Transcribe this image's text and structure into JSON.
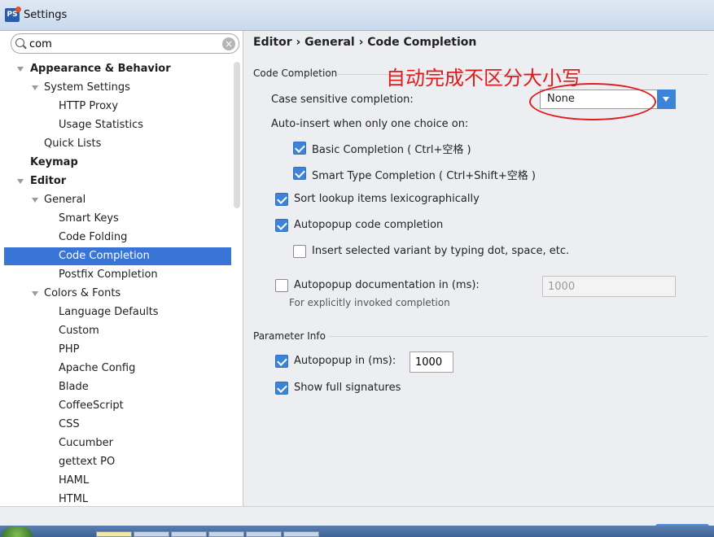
{
  "window": {
    "title": "Settings",
    "icon": "phpstorm-icon"
  },
  "search": {
    "value": "com"
  },
  "tree": [
    {
      "label": "Appearance & Behavior",
      "level": 0,
      "bold": true,
      "expanded": true
    },
    {
      "label": "System Settings",
      "level": 1,
      "expanded": true
    },
    {
      "label": "HTTP Proxy",
      "level": 2
    },
    {
      "label": "Usage Statistics",
      "level": 2
    },
    {
      "label": "Quick Lists",
      "level": 1
    },
    {
      "label": "Keymap",
      "level": 0,
      "bold": true
    },
    {
      "label": "Editor",
      "level": 0,
      "bold": true,
      "expanded": true
    },
    {
      "label": "General",
      "level": 1,
      "expanded": true
    },
    {
      "label": "Smart Keys",
      "level": 2
    },
    {
      "label": "Code Folding",
      "level": 2
    },
    {
      "label": "Code Completion",
      "level": 2,
      "selected": true
    },
    {
      "label": "Postfix Completion",
      "level": 2
    },
    {
      "label": "Colors & Fonts",
      "level": 1,
      "expanded": true
    },
    {
      "label": "Language Defaults",
      "level": 2
    },
    {
      "label": "Custom",
      "level": 2
    },
    {
      "label": "PHP",
      "level": 2
    },
    {
      "label": "Apache Config",
      "level": 2
    },
    {
      "label": "Blade",
      "level": 2
    },
    {
      "label": "CoffeeScript",
      "level": 2
    },
    {
      "label": "CSS",
      "level": 2
    },
    {
      "label": "Cucumber",
      "level": 2
    },
    {
      "label": "gettext PO",
      "level": 2
    },
    {
      "label": "HAML",
      "level": 2
    },
    {
      "label": "HTML",
      "level": 2
    }
  ],
  "breadcrumb": "Editor › General › Code Completion",
  "code_completion": {
    "section_title": "Code Completion",
    "case_sensitive_label": "Case sensitive completion:",
    "case_sensitive_value": "None",
    "auto_insert_label": "Auto-insert when only one choice on:",
    "basic_completion": {
      "label": "Basic Completion ( Ctrl+空格 )",
      "checked": true
    },
    "smart_type_completion": {
      "label": "Smart Type Completion ( Ctrl+Shift+空格 )",
      "checked": true
    },
    "sort_lookup": {
      "label": "Sort lookup items lexicographically",
      "checked": true
    },
    "autopopup_completion": {
      "label": "Autopopup code completion",
      "checked": true
    },
    "insert_selected_variant": {
      "label": "Insert selected variant by typing dot, space, etc.",
      "checked": false
    },
    "autopopup_documentation": {
      "label": "Autopopup documentation in (ms):",
      "checked": false,
      "value": "1000"
    },
    "documentation_note": "For explicitly invoked completion"
  },
  "parameter_info": {
    "section_title": "Parameter Info",
    "autopopup": {
      "label": "Autopopup in (ms):",
      "checked": true,
      "value": "1000"
    },
    "show_full_signatures": {
      "label": "Show full signatures",
      "checked": true
    }
  },
  "annotation": {
    "text": "自动完成不区分大小写",
    "color": "#e11b1b"
  },
  "colors": {
    "accent": "#3875d7",
    "checkbox": "#3c84d8"
  }
}
